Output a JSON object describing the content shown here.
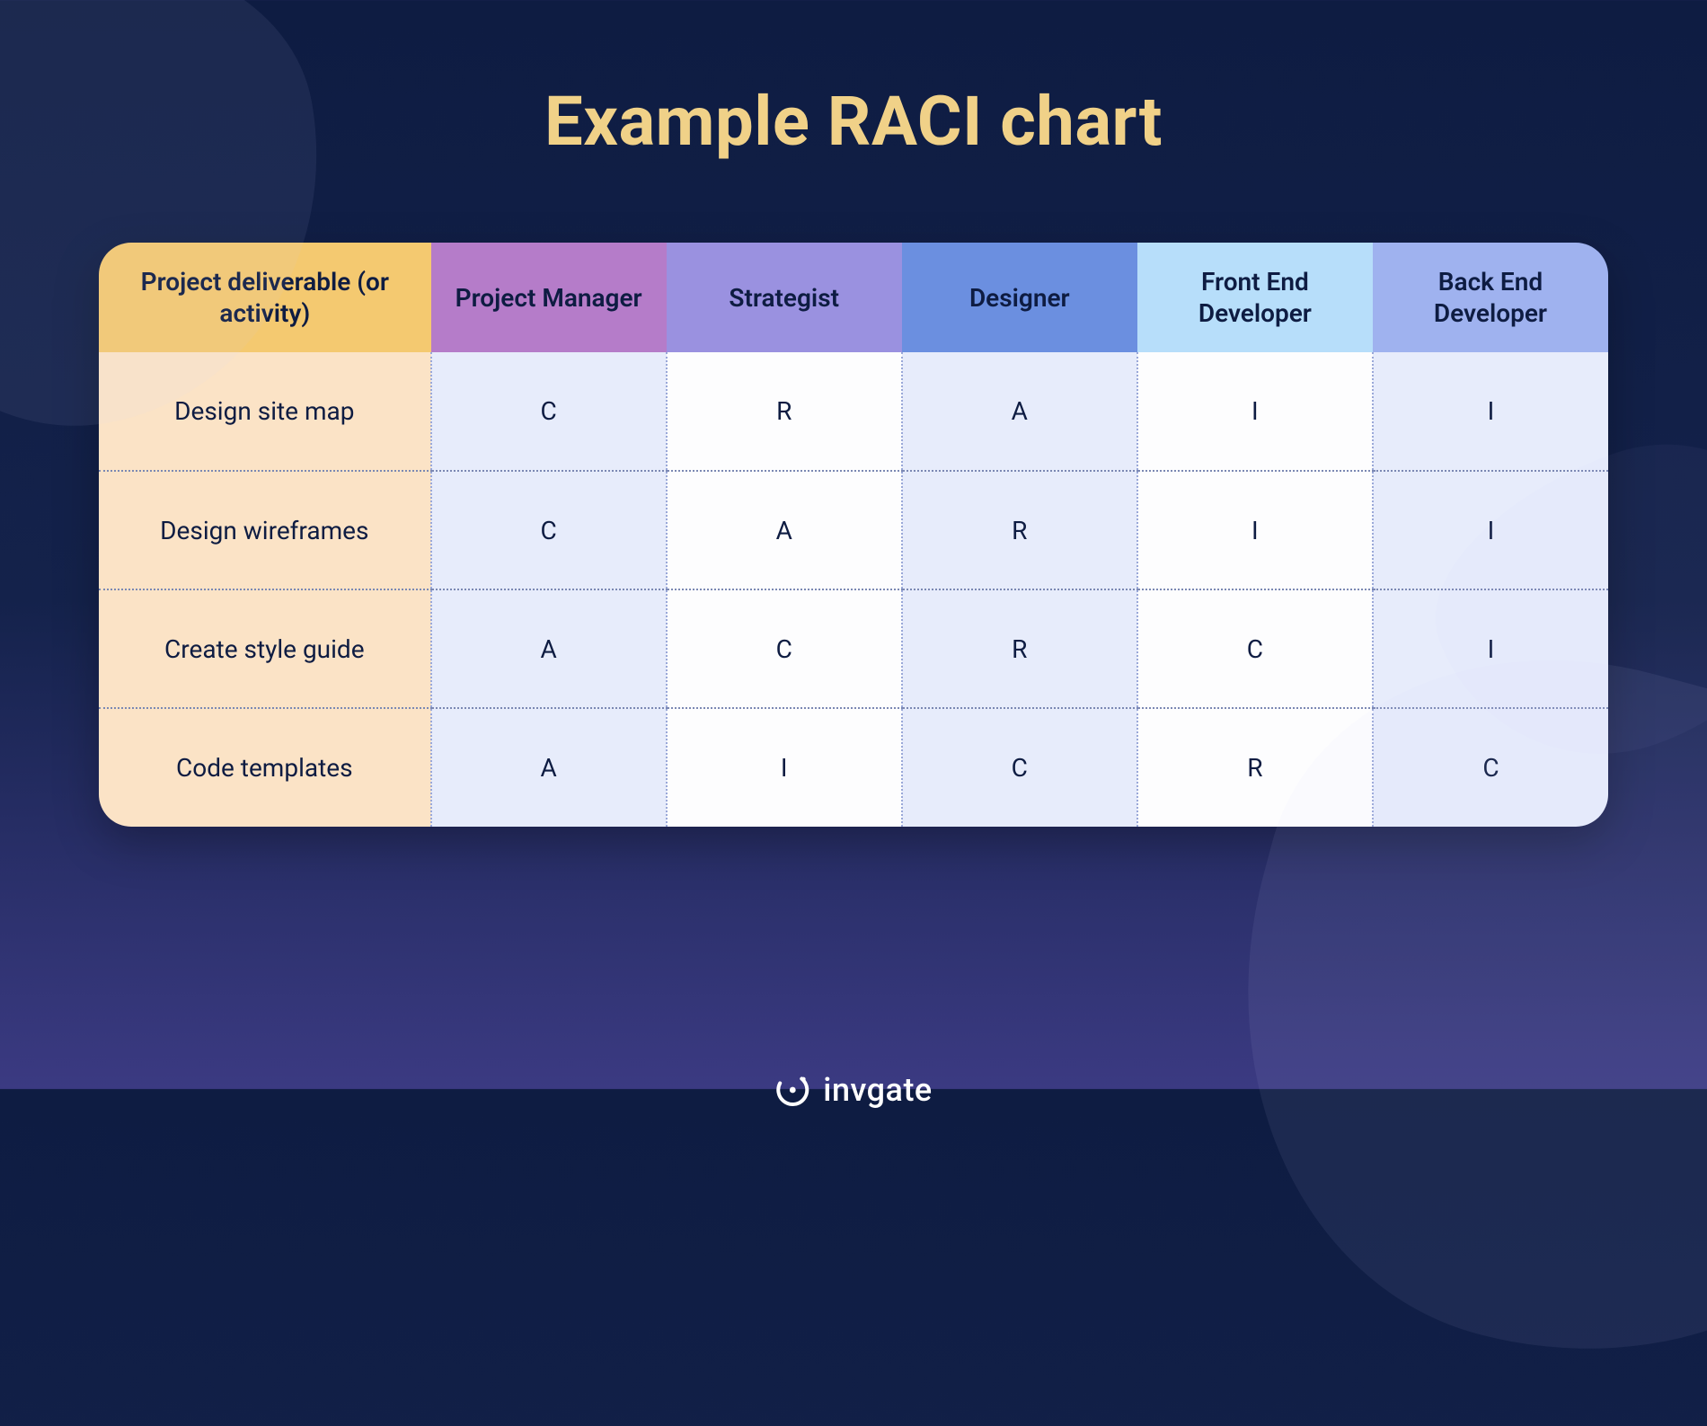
{
  "title": "Example RACI chart",
  "brand": "invgate",
  "chart_data": {
    "type": "table",
    "title": "Example RACI chart",
    "columns": [
      "Project deliverable (or activity)",
      "Project Manager",
      "Strategist",
      "Designer",
      "Front End Developer",
      "Back End Developer"
    ],
    "rows": [
      {
        "activity": "Design site map",
        "values": [
          "C",
          "R",
          "A",
          "I",
          "I"
        ]
      },
      {
        "activity": "Design wireframes",
        "values": [
          "C",
          "A",
          "R",
          "I",
          "I"
        ]
      },
      {
        "activity": "Create style guide",
        "values": [
          "A",
          "C",
          "R",
          "C",
          "I"
        ]
      },
      {
        "activity": "Code templates",
        "values": [
          "A",
          "I",
          "C",
          "R",
          "C"
        ]
      }
    ]
  }
}
